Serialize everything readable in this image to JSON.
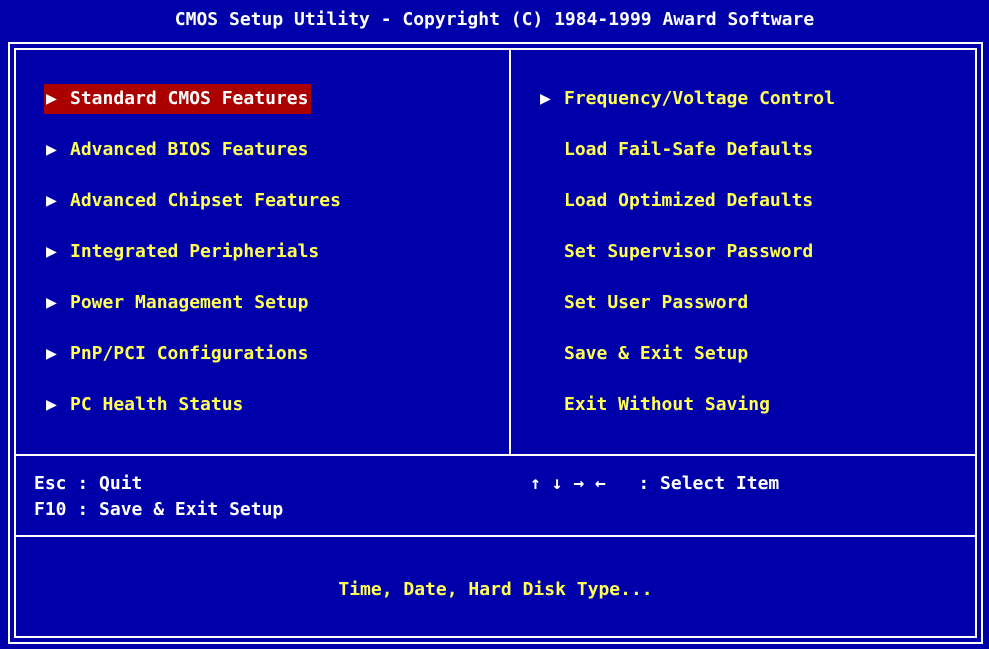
{
  "title": "CMOS Setup Utility - Copyright (C) 1984-1999 Award Software",
  "colors": {
    "background": "#0000aa",
    "frame": "#ffffff",
    "menu_text": "#ffff55",
    "selected_bg": "#aa0000",
    "selected_text": "#ffffff"
  },
  "left_menu": [
    {
      "label": "Standard CMOS Features",
      "arrow": "▶",
      "selected": true
    },
    {
      "label": "Advanced BIOS Features",
      "arrow": "▶",
      "selected": false
    },
    {
      "label": "Advanced Chipset Features",
      "arrow": "▶",
      "selected": false
    },
    {
      "label": "Integrated Peripherials",
      "arrow": "▶",
      "selected": false
    },
    {
      "label": "Power Management Setup",
      "arrow": "▶",
      "selected": false
    },
    {
      "label": "PnP/PCI Configurations",
      "arrow": "▶",
      "selected": false
    },
    {
      "label": "PC Health Status",
      "arrow": "▶",
      "selected": false
    }
  ],
  "right_menu": [
    {
      "label": "Frequency/Voltage Control",
      "arrow": "▶",
      "has_submenu": true
    },
    {
      "label": "Load Fail-Safe Defaults",
      "arrow": "",
      "has_submenu": false
    },
    {
      "label": "Load Optimized Defaults",
      "arrow": "",
      "has_submenu": false
    },
    {
      "label": "Set Supervisor Password",
      "arrow": "",
      "has_submenu": false
    },
    {
      "label": "Set User Password",
      "arrow": "",
      "has_submenu": false
    },
    {
      "label": "Save & Exit Setup",
      "arrow": "",
      "has_submenu": false
    },
    {
      "label": "Exit Without Saving",
      "arrow": "",
      "has_submenu": false
    }
  ],
  "help": {
    "esc_key": "Esc",
    "esc_action": "Quit",
    "f10_key": "F10",
    "f10_action": "Save & Exit Setup",
    "arrows": "↑ ↓ → ←",
    "arrows_action": "Select Item"
  },
  "status_text": "Time, Date, Hard Disk Type..."
}
